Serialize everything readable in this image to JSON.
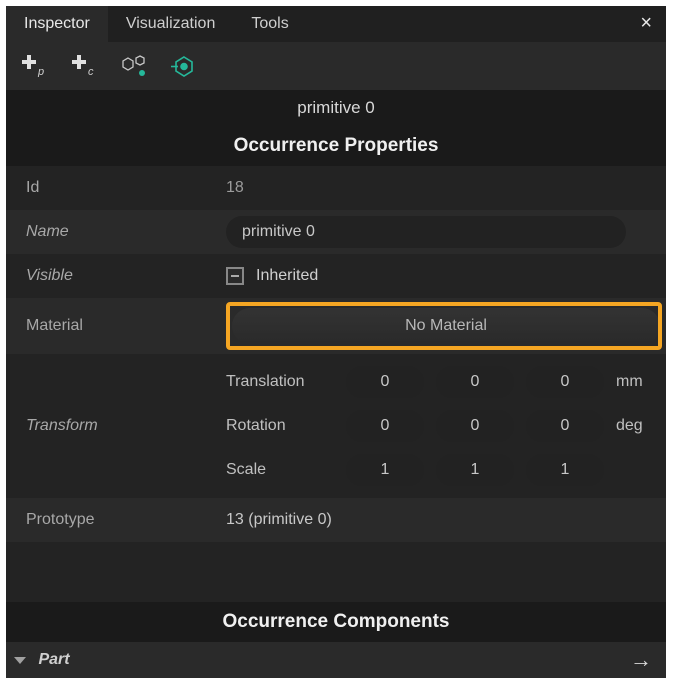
{
  "tabs": {
    "items": [
      "Inspector",
      "Visualization",
      "Tools"
    ],
    "activeIndex": 0
  },
  "toolbar_icons": [
    "add-p",
    "add-c",
    "molecule",
    "target"
  ],
  "object_name": "primitive 0",
  "sections": {
    "properties_title": "Occurrence Properties",
    "components_title": "Occurrence Components"
  },
  "properties": {
    "id_label": "Id",
    "id_value": "18",
    "name_label": "Name",
    "name_value": "primitive 0",
    "visible_label": "Visible",
    "visible_text": "Inherited",
    "visible_state": "indeterminate",
    "material_label": "Material",
    "material_button": "No Material",
    "transform_label": "Transform",
    "transform": {
      "rows": [
        {
          "label": "Translation",
          "x": "0",
          "y": "0",
          "z": "0",
          "unit": "mm"
        },
        {
          "label": "Rotation",
          "x": "0",
          "y": "0",
          "z": "0",
          "unit": "deg"
        },
        {
          "label": "Scale",
          "x": "1",
          "y": "1",
          "z": "1",
          "unit": ""
        }
      ]
    },
    "prototype_label": "Prototype",
    "prototype_value": "13 (primitive 0)"
  },
  "components": {
    "part_label": "Part"
  }
}
